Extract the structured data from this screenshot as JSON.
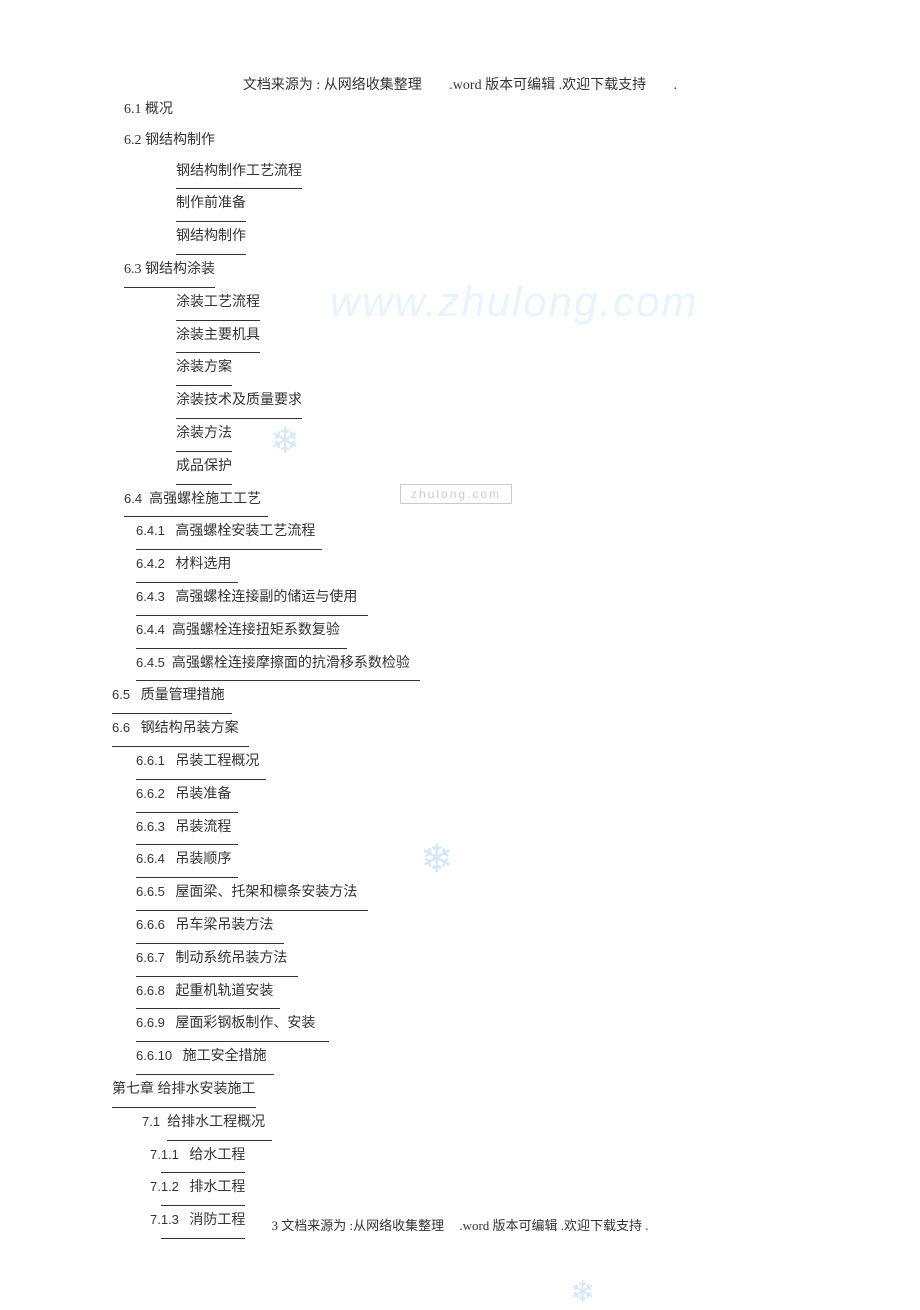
{
  "header": {
    "part1": "文档来源为 : 从网络收集整理",
    "part2": ".word 版本可编辑 .欢迎下载支持",
    "part3": "."
  },
  "watermarks": {
    "url_light": "www.zhulong.com",
    "box_text": "zhulong.com"
  },
  "toc": {
    "s61": "6.1  概况",
    "s62": "6.2  钢结构制作",
    "s62_1": "钢结构制作工艺流程",
    "s62_2": "制作前准备",
    "s62_3": "钢结构制作",
    "s63": "6.3  钢结构涂装",
    "s63_1": "涂装工艺流程",
    "s63_2": "涂装主要机具",
    "s63_3": "涂装方案",
    "s63_4": "涂装技术及质量要求",
    "s63_5": "涂装方法",
    "s63_6": "成品保护",
    "s64": "高强螺栓施工工艺",
    "s64_num": "6.4",
    "s641_num": "6.4.1",
    "s641_txt": "高强螺栓安装工艺流程",
    "s642_num": "6.4.2",
    "s642_txt": "材料选用",
    "s643_num": "6.4.3",
    "s643_txt": "高强螺栓连接副的储运与使用",
    "s644_num": "6.4.4",
    "s644_txt": "高强螺栓连接扭矩系数复验",
    "s645_num": "6.4.5",
    "s645_txt": "高强螺栓连接摩擦面的抗滑移系数检验",
    "s65_num": "6.5",
    "s65_txt": "质量管理措施",
    "s66_num": "6.6",
    "s66_txt": "钢结构吊装方案",
    "s661_num": "6.6.1",
    "s661_txt": "吊装工程概况",
    "s662_num": "6.6.2",
    "s662_txt": "吊装准备",
    "s663_num": "6.6.3",
    "s663_txt": "吊装流程",
    "s664_num": "6.6.4",
    "s664_txt": "吊装顺序",
    "s665_num": "6.6.5",
    "s665_txt": "屋面梁、托架和檩条安装方法",
    "s666_num": "6.6.6",
    "s666_txt": "吊车梁吊装方法",
    "s667_num": "6.6.7",
    "s667_txt": "制动系统吊装方法",
    "s668_num": "6.6.8",
    "s668_txt": "起重机轨道安装",
    "s669_num": "6.6.9",
    "s669_txt": "屋面彩钢板制作、安装",
    "s6610_num": "6.6.10",
    "s6610_txt": "施工安全措施",
    "ch7": "第七章      给排水安装施工",
    "s71_num": "7.1",
    "s71_txt": "给排水工程概况",
    "s711_num": "7.1.1",
    "s711_txt": "给水工程",
    "s712_num": "7.1.2",
    "s712_txt": "排水工程",
    "s713_num": "7.1.3",
    "s713_txt": "消防工程"
  },
  "footer": {
    "part1": "3 文档来源为 :从网络收集整理",
    "part2": ".word 版本可编辑 .欢迎下载支持 ."
  }
}
